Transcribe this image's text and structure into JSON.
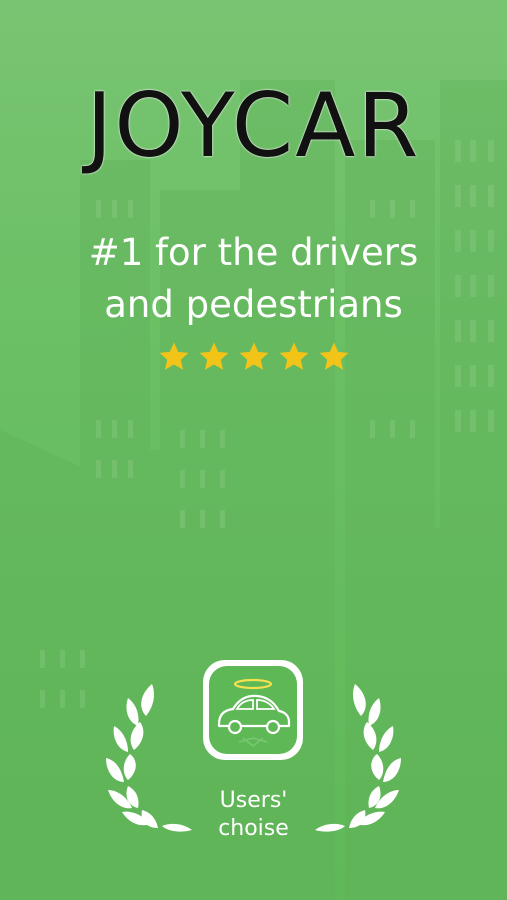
{
  "app": {
    "title": "JOYCAR",
    "tagline_line1": "#1 for the drivers",
    "tagline_line2": "and pedestrians",
    "rating_stars": 5
  },
  "award": {
    "line1": "Users'",
    "line2": "choise"
  },
  "colors": {
    "background": "#6abf63",
    "star": "#f2c418",
    "text_primary": "#111111",
    "text_light": "#ffffff"
  },
  "icons": [
    "star-icon",
    "car-icon",
    "halo-icon",
    "laurel-icon"
  ]
}
